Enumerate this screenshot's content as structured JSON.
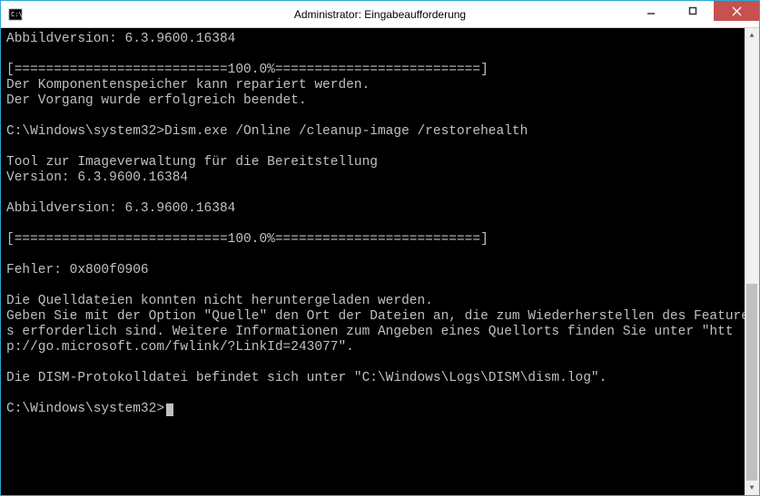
{
  "window": {
    "title": "Administrator: Eingabeaufforderung"
  },
  "terminal": {
    "lines": [
      "Abbildversion: 6.3.9600.16384",
      "",
      "[===========================100.0%==========================] ",
      "Der Komponentenspeicher kann repariert werden.",
      "Der Vorgang wurde erfolgreich beendet.",
      "",
      "C:\\Windows\\system32>Dism.exe /Online /cleanup-image /restorehealth",
      "",
      "Tool zur Imageverwaltung für die Bereitstellung",
      "Version: 6.3.9600.16384",
      "",
      "Abbildversion: 6.3.9600.16384",
      "",
      "[===========================100.0%==========================] ",
      "",
      "Fehler: 0x800f0906",
      "",
      "Die Quelldateien konnten nicht heruntergeladen werden.",
      "Geben Sie mit der Option \"Quelle\" den Ort der Dateien an, die zum Wiederherstellen des Features erforderlich sind. Weitere Informationen zum Angeben eines Quellorts finden Sie unter \"http://go.microsoft.com/fwlink/?LinkId=243077\".",
      "",
      "Die DISM-Protokolldatei befindet sich unter \"C:\\Windows\\Logs\\DISM\\dism.log\".",
      ""
    ],
    "prompt": "C:\\Windows\\system32>"
  }
}
